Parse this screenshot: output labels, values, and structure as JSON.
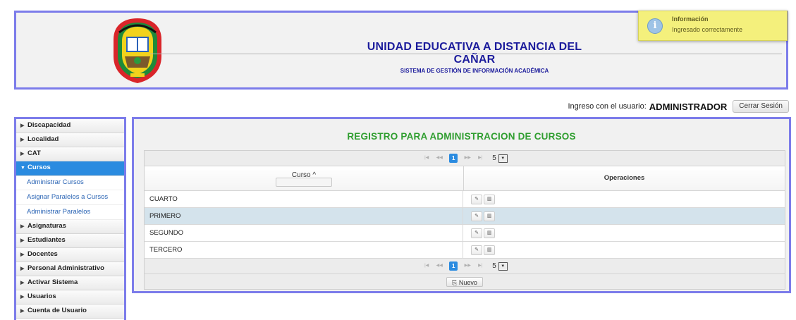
{
  "header": {
    "title": "UNIDAD EDUCATIVA A DISTANCIA DEL CAÑAR",
    "subtitle": "SISTEMA DE GESTIÓN DE INFORMACIÓN ACADÉMICA"
  },
  "notification": {
    "title": "Información",
    "message": "Ingresado correctamente",
    "icon": "info-icon"
  },
  "userbar": {
    "prefix": "Ingreso con el usuario:",
    "username": "ADMINISTRADOR",
    "logout_label": "Cerrar Sesión"
  },
  "sidebar": {
    "items": [
      {
        "label": "Discapacidad"
      },
      {
        "label": "Localidad"
      },
      {
        "label": "CAT"
      },
      {
        "label": "Cursos"
      },
      {
        "label": "Asignaturas"
      },
      {
        "label": "Estudiantes"
      },
      {
        "label": "Docentes"
      },
      {
        "label": "Personal Administrativo"
      },
      {
        "label": "Activar Sistema"
      },
      {
        "label": "Usuarios"
      },
      {
        "label": "Cuenta de Usuario"
      }
    ],
    "submenu": [
      {
        "label": "Administrar Cursos"
      },
      {
        "label": "Asignar Paralelos a Cursos"
      },
      {
        "label": "Administrar Paralelos"
      }
    ]
  },
  "main": {
    "title": "REGISTRO PARA ADMINISTRACION DE CURSOS",
    "paginator": {
      "current_page": "1",
      "rows_per_page": "5"
    },
    "columns": {
      "curso": "Curso ^",
      "operaciones": "Operaciones"
    },
    "rows": [
      {
        "curso": "CUARTO"
      },
      {
        "curso": "PRIMERO"
      },
      {
        "curso": "SEGUNDO"
      },
      {
        "curso": "TERCERO"
      }
    ],
    "new_label": "Nuevo"
  },
  "colors": {
    "accent": "#2a8be0",
    "border": "#7c7cea",
    "title_green": "#2f9e2f",
    "header_blue": "#1c1c9c",
    "notification_bg": "#f4f07c"
  }
}
